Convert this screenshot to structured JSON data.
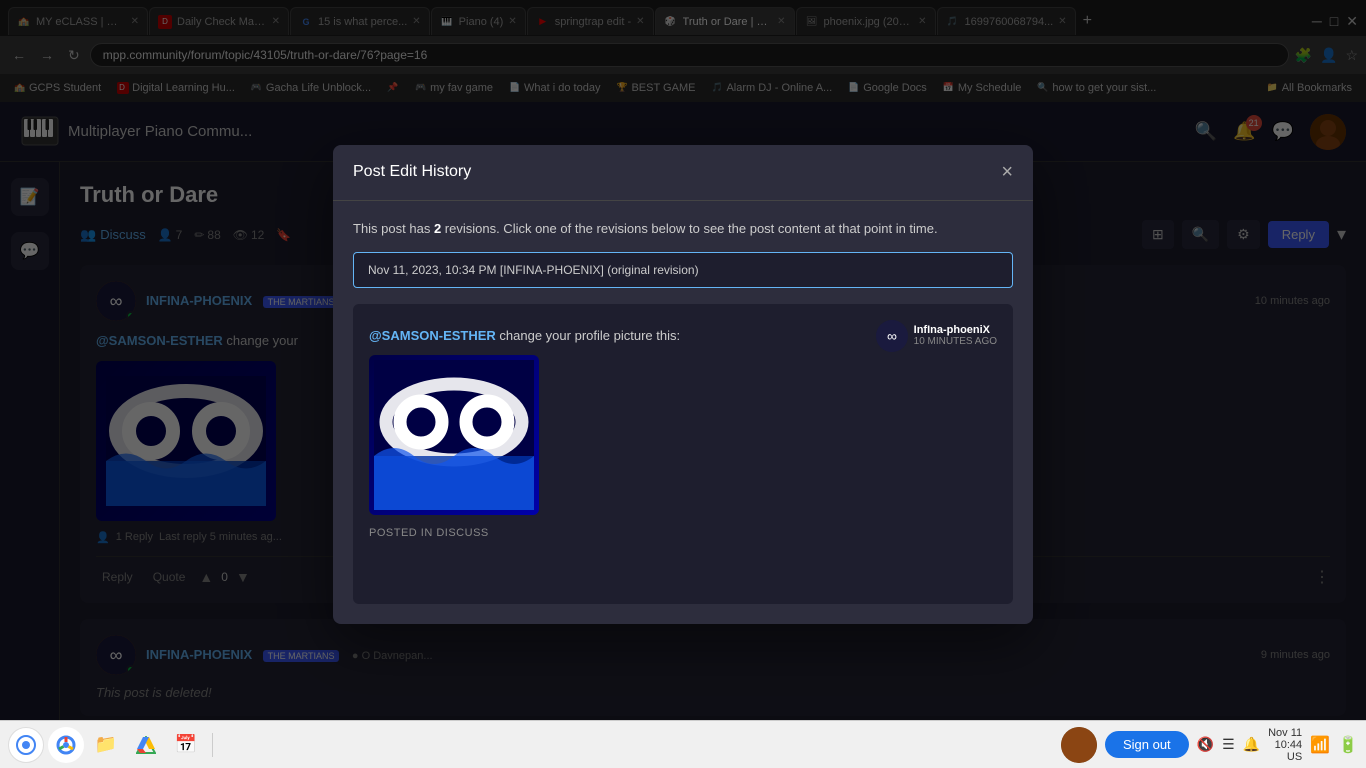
{
  "browser": {
    "url": "mpp.community/forum/topic/43105/truth-or-dare/76?page=16",
    "tabs": [
      {
        "id": "t1",
        "favicon": "🏫",
        "label": "MY eCLASS | Gw...",
        "active": false
      },
      {
        "id": "t2",
        "favicon": "📋",
        "label": "Daily Check Main...",
        "active": false
      },
      {
        "id": "t3",
        "favicon": "🔍",
        "label": "15 is what perce...",
        "active": false
      },
      {
        "id": "t4",
        "favicon": "🎹",
        "label": "Piano (4)",
        "active": false
      },
      {
        "id": "t5",
        "favicon": "▶",
        "label": "springtrap edit -",
        "active": false
      },
      {
        "id": "t6",
        "favicon": "🎲",
        "label": "Truth or Dare | m...",
        "active": true
      },
      {
        "id": "t7",
        "favicon": "🖼",
        "label": "phoenix.jpg (200...",
        "active": false
      },
      {
        "id": "t8",
        "favicon": "🎵",
        "label": "1699760068794...",
        "active": false
      }
    ],
    "bookmarks": [
      {
        "favicon": "🏫",
        "label": "GCPS Student"
      },
      {
        "favicon": "📋",
        "label": "Digital Learning Hu..."
      },
      {
        "favicon": "🎮",
        "label": "Gacha Life Unblock..."
      },
      {
        "favicon": "📌",
        "label": ""
      },
      {
        "favicon": "🎮",
        "label": "my fav game"
      },
      {
        "favicon": "📄",
        "label": "What i do today"
      },
      {
        "favicon": "🏆",
        "label": "BEST GAME"
      },
      {
        "favicon": "🎵",
        "label": "Alarm DJ - Online A..."
      },
      {
        "favicon": "📄",
        "label": "Google Docs"
      },
      {
        "favicon": "📅",
        "label": "My Schedule"
      },
      {
        "favicon": "🔍",
        "label": "how to get your sist..."
      },
      {
        "favicon": "📁",
        "label": "All Bookmarks"
      }
    ]
  },
  "site": {
    "title": "Multiplayer Piano Commu...",
    "notification_count": "21"
  },
  "forum": {
    "post_title": "Truth or Dare",
    "discuss_tab": "Discuss",
    "members_count": "7",
    "replies_count": "88",
    "views_count": "12",
    "reply_button": "Reply",
    "toolbar_icons": [
      "⊞",
      "🔍",
      "⚙"
    ]
  },
  "posts": [
    {
      "id": "p1",
      "author": "INFINA-PHOENIX",
      "badge": "THE MARTIANS",
      "time": "10 minutes ago",
      "text_prefix": "@SAMSON-ESTHER change your",
      "has_image": true,
      "reply_count": "1 Reply",
      "last_reply": "Last reply 5 minutes ag...",
      "footer": {
        "reply_label": "Reply",
        "quote_label": "Quote",
        "vote_count": "0"
      }
    },
    {
      "id": "p2",
      "author": "INFINA-PHOENIX",
      "badge": "THE MARTIANS",
      "time": "9 minutes ago",
      "deleted": true,
      "deleted_text": "This post is deleted!"
    }
  ],
  "post_edit_history_modal": {
    "title": "Post Edit History",
    "description_prefix": "This post has ",
    "revisions_count": "2",
    "description_suffix": " revisions. Click one of the revisions below to see the post content at that point in time.",
    "revision_label": "Nov 11, 2023, 10:34 PM [INFINA-PHOENIX] (original revision)",
    "revision_content": {
      "mention": "@SAMSON-ESTHER",
      "text": " change your profile picture this:",
      "posted_in": "POSTED IN DISCUSS"
    },
    "close_button": "×",
    "user": {
      "name": "InfIna-phoeniX",
      "time": "10 MINUTES AGO"
    }
  },
  "taskbar": {
    "sign_out_label": "Sign out",
    "datetime": "Nov 11",
    "time": "10:44",
    "region": "US"
  }
}
